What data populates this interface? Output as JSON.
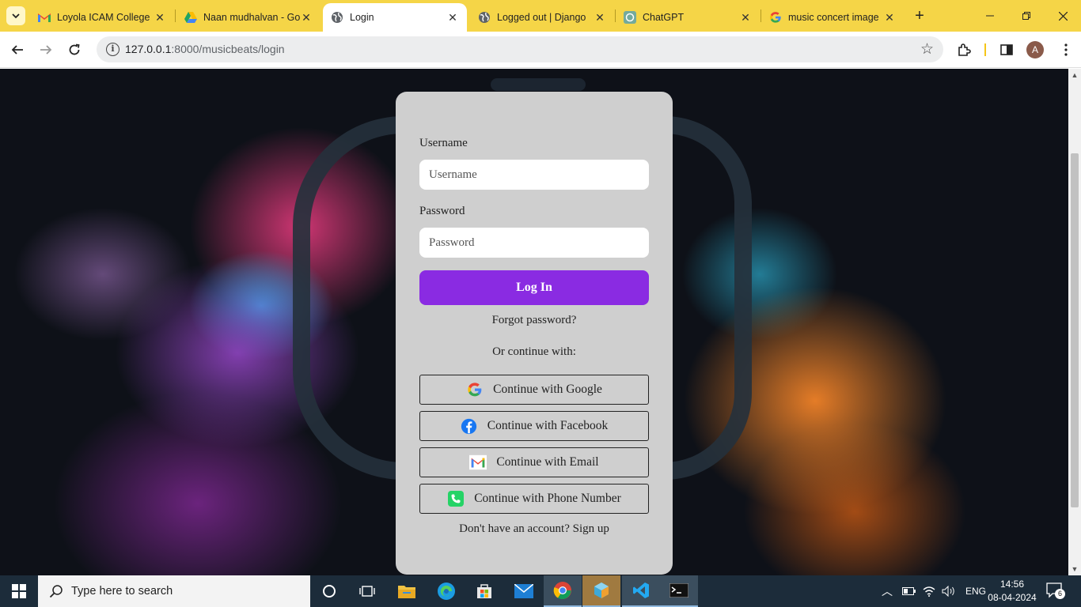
{
  "browser": {
    "tabs": [
      {
        "title": "Loyola ICAM College",
        "favicon": "gmail-icon",
        "active": false
      },
      {
        "title": "Naan mudhalvan - Go",
        "favicon": "google-drive-icon",
        "active": false
      },
      {
        "title": "Login",
        "favicon": "globe-icon",
        "active": true
      },
      {
        "title": "Logged out | Django",
        "favicon": "globe-icon",
        "active": false
      },
      {
        "title": "ChatGPT",
        "favicon": "chatgpt-icon",
        "active": false
      },
      {
        "title": "music concert image",
        "favicon": "google-icon",
        "active": false
      }
    ],
    "url_host": "127.0.0.1",
    "url_path": ":8000/musicbeats/login",
    "profile_initial": "A"
  },
  "login": {
    "username_label": "Username",
    "username_placeholder": "Username",
    "password_label": "Password",
    "password_placeholder": "Password",
    "login_button": "Log In",
    "forgot_password": "Forgot password?",
    "or_continue": "Or continue with:",
    "social": [
      {
        "label": "Continue with Google",
        "icon": "google-icon"
      },
      {
        "label": "Continue with Facebook",
        "icon": "facebook-icon"
      },
      {
        "label": "Continue with Email",
        "icon": "gmail-icon"
      },
      {
        "label": "Continue with Phone Number",
        "icon": "phone-icon"
      }
    ],
    "signup": "Don't have an account? Sign up"
  },
  "taskbar": {
    "search_placeholder": "Type here to search",
    "language": "ENG",
    "time": "14:56",
    "date": "08-04-2024",
    "notification_count": "6"
  }
}
